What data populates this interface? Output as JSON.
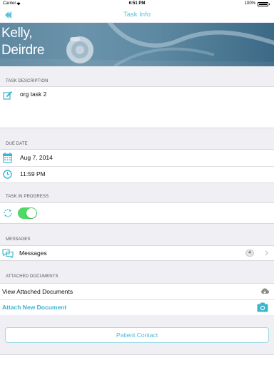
{
  "status_bar": {
    "carrier": "Carrier",
    "time": "6:51 PM",
    "battery": "100%"
  },
  "nav": {
    "title": "Task Info",
    "back_icon": "double-chevron-left-icon"
  },
  "patient": {
    "last_name": "Kelly,",
    "first_name": "Deirdre"
  },
  "task_description": {
    "header": "TASK DESCRIPTION",
    "icon": "edit-icon",
    "value": "org task 2"
  },
  "due_date": {
    "header": "DUE DATE",
    "date_icon": "calendar-icon",
    "date": "Aug 7, 2014",
    "time_icon": "clock-icon",
    "time": "11:59 PM"
  },
  "task_in_progress": {
    "header": "TASK IN PROGRESS",
    "icon": "sync-icon",
    "toggle_on": true
  },
  "messages": {
    "header": "MESSAGES",
    "icon": "chat-bubbles-icon",
    "label": "Messages",
    "count": "4"
  },
  "attached_documents": {
    "header": "ATTACHED DOCUMENTS",
    "view_label": "View Attached Documents",
    "view_icon": "cloud-download-icon",
    "attach_label": "Attach New Document",
    "attach_icon": "camera-icon"
  },
  "footer": {
    "patient_contact_label": "Patient Contact"
  },
  "colors": {
    "accent": "#5bc3d8",
    "toggle_on": "#4cd964",
    "banner": "#5f88a1",
    "background": "#efeff4"
  }
}
